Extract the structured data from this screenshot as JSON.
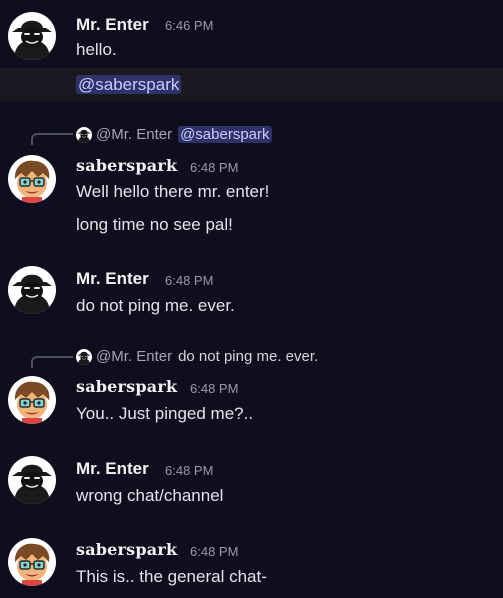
{
  "messages": [
    {
      "author": "Mr. Enter",
      "time": "6:46 PM",
      "lines": [
        "hello."
      ],
      "mention_line": "@saberspark"
    },
    {
      "author": "saberspark",
      "time": "6:48 PM",
      "reply": {
        "author": "@Mr. Enter",
        "text": "@saberspark"
      },
      "lines": [
        "Well hello there mr. enter!",
        "long time no see pal!"
      ]
    },
    {
      "author": "Mr. Enter",
      "time": "6:48 PM",
      "lines": [
        "do not ping me. ever."
      ]
    },
    {
      "author": "saberspark",
      "time": "6:48 PM",
      "reply": {
        "author": "@Mr. Enter",
        "text": "do not ping me. ever."
      },
      "lines": [
        "You.. Just pinged me?.."
      ]
    },
    {
      "author": "Mr. Enter",
      "time": "6:48 PM",
      "lines": [
        "wrong chat/channel"
      ]
    },
    {
      "author": "saberspark",
      "time": "6:48 PM",
      "lines": [
        "This is.. the general chat-"
      ]
    }
  ]
}
